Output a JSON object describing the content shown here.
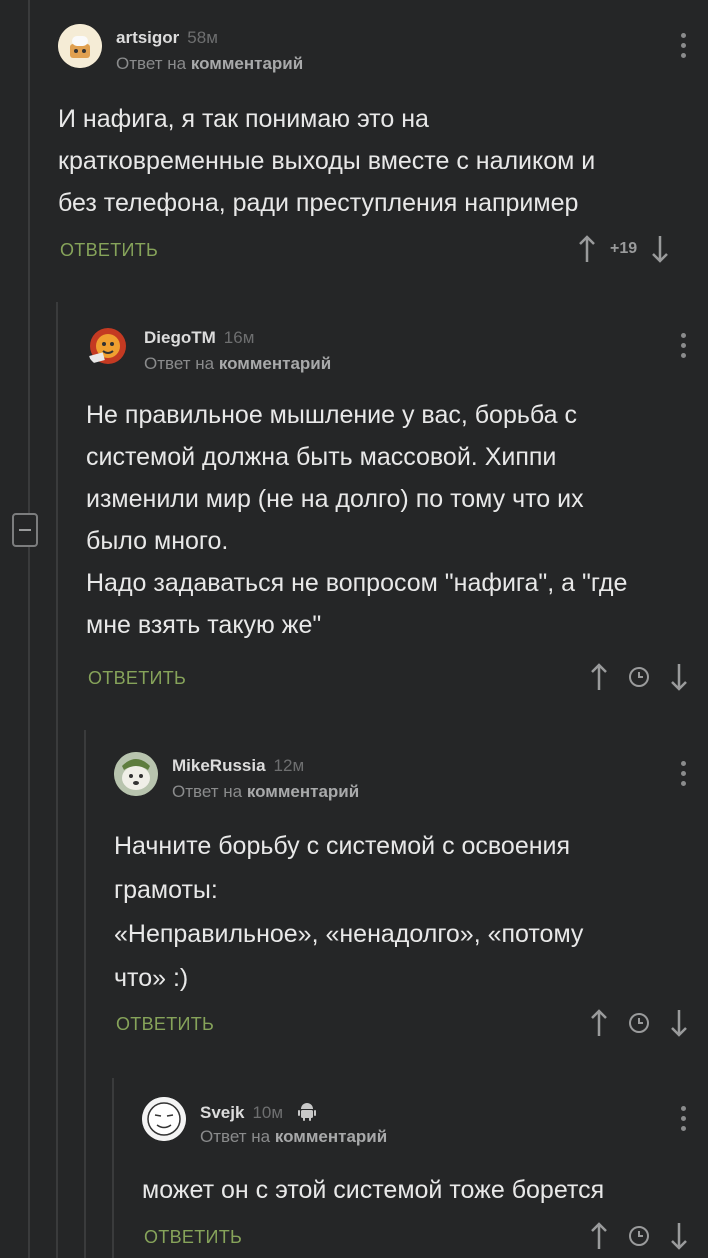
{
  "comments": [
    {
      "author": "artsigor",
      "time": "58м",
      "reply_prefix": "Ответ на",
      "reply_link": "комментарий",
      "text": "И нафига, я так понимаю это на\nкратковременные выходы вместе с наликом и\nбез телефона, ради преступления например",
      "reply_label": "ОТВЕТИТЬ",
      "rating": "+19",
      "avatar_icon": "hat-avatar-icon"
    },
    {
      "author": "DiegoTM",
      "time": "16м",
      "reply_prefix": "Ответ на",
      "reply_link": "комментарий",
      "text": "Не правильное мышление у вас, борьба с\nсистемой должна быть массовой. Хиппи\nизменили мир (не на долго) по тому что их\nбыло много.\nНадо задаваться не вопросом \"нафига\", а \"где\nмне взять такую же\"",
      "reply_label": "ОТВЕТИТЬ",
      "avatar_icon": "lion-avatar-icon"
    },
    {
      "author": "MikeRussia",
      "time": "12м",
      "reply_prefix": "Ответ на",
      "reply_link": "комментарий",
      "text": "Начните борьбу с системой с освоения\nграмоты:\n «Неправильное», «ненадолго», «потому\nчто» :)",
      "reply_label": "ОТВЕТИТЬ",
      "avatar_icon": "dog-avatar-icon"
    },
    {
      "author": "Svejk",
      "time": "10м",
      "reply_prefix": "Ответ на",
      "reply_link": "комментарий",
      "text": "может он с этой системой тоже борется",
      "reply_label": "ОТВЕТИТЬ",
      "avatar_icon": "meme-face-avatar-icon",
      "platform_icon": "android-icon"
    }
  ],
  "colors": {
    "background": "#252627",
    "accent_green": "#86a35a",
    "muted": "#6e6f70"
  }
}
